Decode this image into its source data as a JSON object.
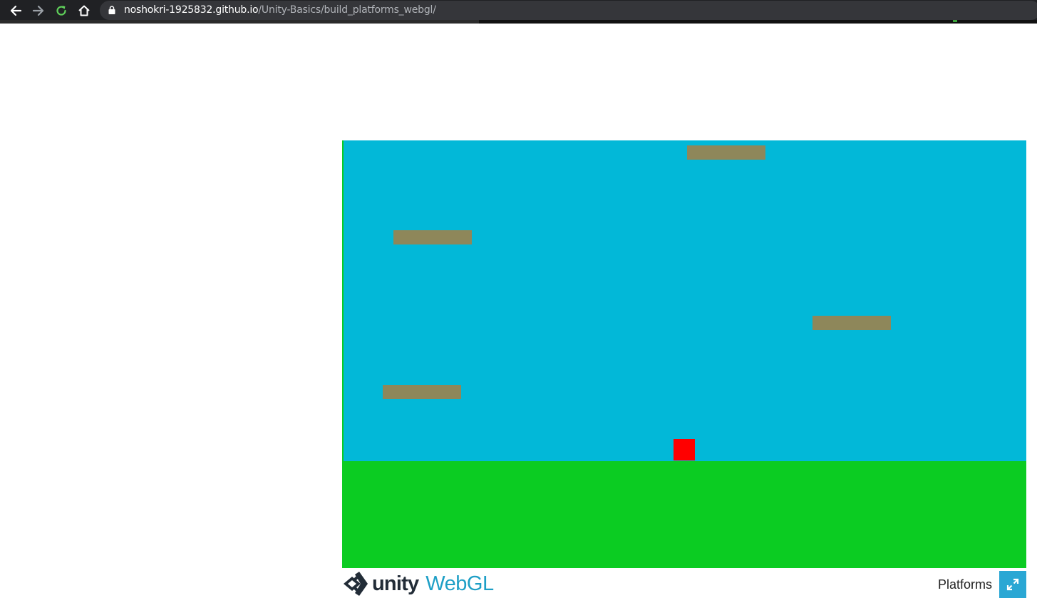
{
  "browser": {
    "url_host": "noshokri-1925832.github.io",
    "url_path": "/Unity-Basics/build_platforms_webgl/"
  },
  "colors": {
    "sky": "#02b8d8",
    "ground": "#0bcc22",
    "platform": "#8e875a",
    "player": "#ff0000",
    "webgl_accent": "#1e9fc6"
  },
  "footer": {
    "logo_text": "unity",
    "logo_suffix": "WebGL",
    "title": "Platforms",
    "fullscreen_icon": "fullscreen-expand-icon"
  }
}
